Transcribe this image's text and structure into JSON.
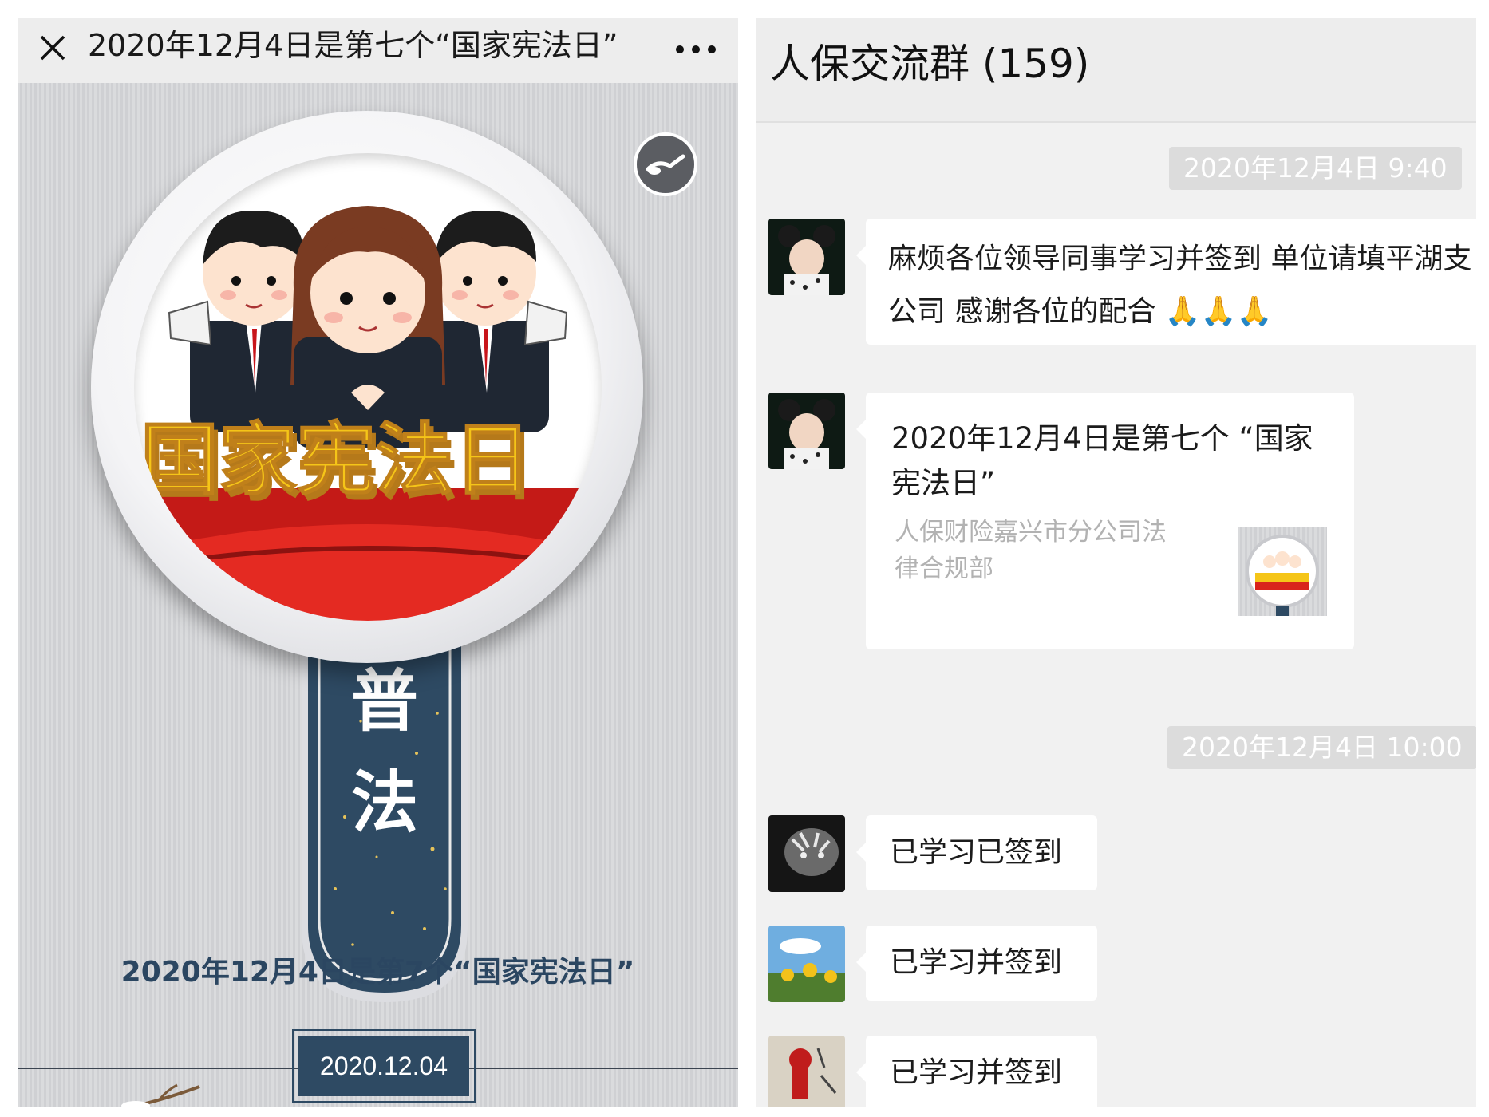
{
  "article": {
    "header_title": "2020年12月4日是第七个“国家宪法日”",
    "close_icon": "close-icon",
    "more_icon": "more-icon",
    "music_icon": "music-icon",
    "banner_title": "国家宪法日",
    "badge_char_1": "普",
    "badge_char_2": "法",
    "caption": "2020年12月4日是第7个“国家宪法日”",
    "date": "2020.12.04",
    "colors": {
      "navy": "#2e4a63",
      "banner_yellow": "#f5c518",
      "banner_red": "#d9231c"
    }
  },
  "chat": {
    "title": "人保交流群 (159)",
    "timestamps": [
      "2020年12月4日 9:40",
      "2020年12月4日 10:00"
    ],
    "messages": [
      {
        "type": "text",
        "text": "麻烦各位领导同事学习并签到 单位请填平湖支公司 感谢各位的配合",
        "emoji": "🙏🙏🙏"
      },
      {
        "type": "link",
        "title": "2020年12月4日是第七个 “国家宪法日”",
        "source": "人保财险嘉兴市分公司法律合规部"
      },
      {
        "type": "text",
        "text": "已学习已签到"
      },
      {
        "type": "text",
        "text": "已学习并签到"
      },
      {
        "type": "text",
        "text": "已学习并签到"
      }
    ]
  }
}
